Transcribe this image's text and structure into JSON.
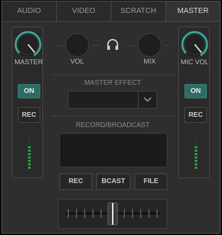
{
  "tabs": [
    {
      "label": "AUDIO",
      "active": false
    },
    {
      "label": "VIDEO",
      "active": false
    },
    {
      "label": "SCRATCH",
      "active": false
    },
    {
      "label": "MASTER",
      "active": true
    }
  ],
  "left_strip": {
    "knob_label": "MASTER",
    "on_label": "ON",
    "rec_label": "REC",
    "meter_lit": 7,
    "meter_total": 10
  },
  "right_strip": {
    "knob_label": "MIC VOL",
    "on_label": "ON",
    "rec_label": "REC",
    "meter_lit": 7,
    "meter_total": 10
  },
  "center": {
    "vol_label": "VOL",
    "mix_label": "MIX",
    "master_effect_label": "MASTER EFFECT",
    "master_effect_value": "",
    "record_broadcast_label": "RECORD/BROADCAST",
    "rec_button": "REC",
    "bcast_button": "BCAST",
    "file_button": "FILE"
  },
  "colors": {
    "accent": "#2d6b63",
    "knob_ring": "#3fa69c",
    "meter_green": "#2aa04a"
  },
  "icons": {
    "headphones": "headphones-icon",
    "dropdown": "chevron-down-icon"
  }
}
